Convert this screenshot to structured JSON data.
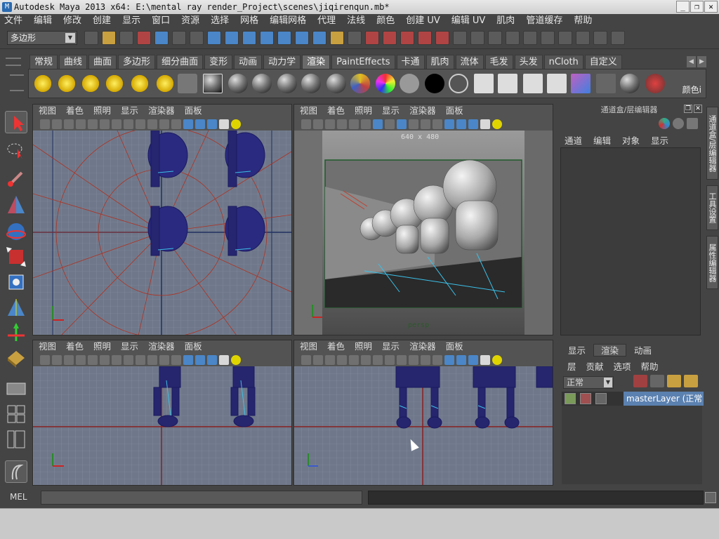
{
  "window": {
    "title": "Autodesk Maya 2013 x64: E:\\mental ray render_Project\\scenes\\jiqirenqun.mb*",
    "controls": [
      "_",
      "❐",
      "✕"
    ]
  },
  "menubar": [
    "文件",
    "编辑",
    "修改",
    "创建",
    "显示",
    "窗口",
    "资源",
    "选择",
    "网格",
    "编辑网格",
    "代理",
    "法线",
    "颜色",
    "创建 UV",
    "编辑 UV",
    "肌肉",
    "管道缓存",
    "帮助"
  ],
  "statusline": {
    "mode": "多边形"
  },
  "shelf": {
    "tabs": [
      "常规",
      "曲线",
      "曲面",
      "多边形",
      "细分曲面",
      "变形",
      "动画",
      "动力学",
      "渲染",
      "PaintEffects",
      "卡通",
      "肌肉",
      "流体",
      "毛发",
      "头发",
      "nCloth",
      "自定义"
    ],
    "active_tab": "渲染",
    "last_label": "颜色i"
  },
  "panels": {
    "menu": [
      "视图",
      "着色",
      "照明",
      "显示",
      "渲染器",
      "面板"
    ],
    "persp_label": "persp",
    "resolution_gate": "640 x 480"
  },
  "channel_box": {
    "title": "通道盒/层编辑器",
    "menu": [
      "通道",
      "编辑",
      "对象",
      "显示"
    ]
  },
  "side_tabs": [
    "通道盒/层编辑器",
    "工具设置",
    "属性编辑器"
  ],
  "layer_editor": {
    "tabs": [
      "显示",
      "渲染",
      "动画"
    ],
    "active_tab": "渲染",
    "menu": [
      "层",
      "贡献",
      "选项",
      "帮助"
    ],
    "mode": "正常",
    "layer_name": "masterLayer (正常"
  },
  "command_line": {
    "label": "MEL"
  }
}
